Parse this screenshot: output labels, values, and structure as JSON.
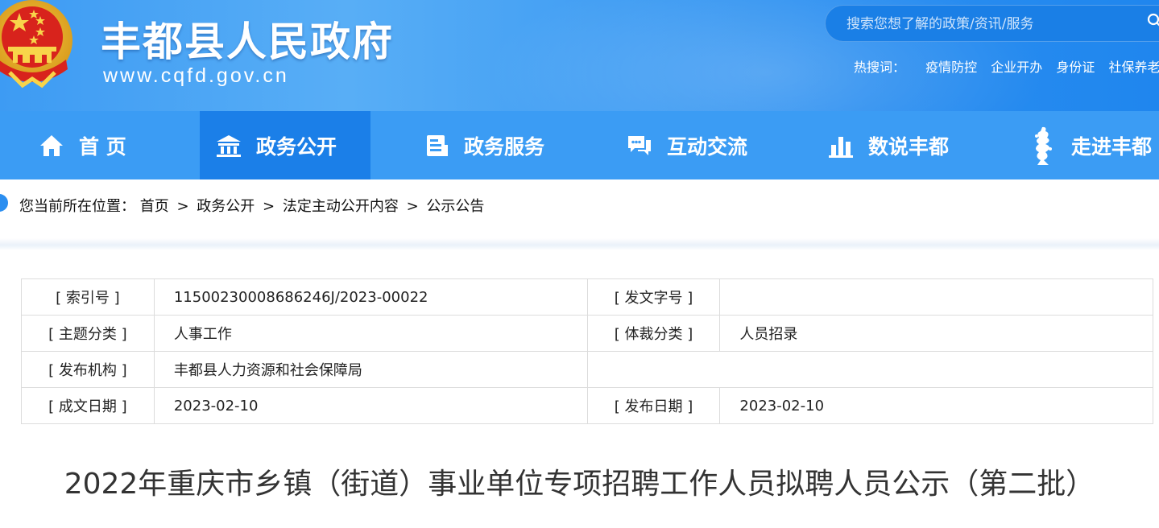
{
  "header": {
    "site_title": "丰都县人民政府",
    "site_domain": "www.cqfd.gov.cn",
    "search_placeholder": "搜索您想了解的政策/资讯/服务",
    "hot_label": "热搜词：",
    "hot_words": [
      "疫情防控",
      "企业开办",
      "身份证",
      "社保养老"
    ]
  },
  "nav": {
    "items": [
      {
        "label": "首 页",
        "icon": "home-icon"
      },
      {
        "label": "政务公开",
        "icon": "building-icon",
        "active": true
      },
      {
        "label": "政务服务",
        "icon": "document-icon"
      },
      {
        "label": "互动交流",
        "icon": "chat-icon"
      },
      {
        "label": "数说丰都",
        "icon": "bar-chart-icon"
      },
      {
        "label": "走进丰都",
        "icon": "figure-icon"
      }
    ]
  },
  "breadcrumb": {
    "prefix": "您当前所在位置：",
    "items": [
      "首页",
      "政务公开",
      "法定主动公开内容",
      "公示公告"
    ],
    "separator": ">"
  },
  "meta": {
    "rows": [
      {
        "l1": "[ 索引号 ]",
        "v1": "11500230008686246J/2023-00022",
        "l2": "[ 发文字号 ]",
        "v2": ""
      },
      {
        "l1": "[ 主题分类 ]",
        "v1": "人事工作",
        "l2": "[ 体裁分类 ]",
        "v2": "人员招录"
      },
      {
        "l1": "[ 发布机构 ]",
        "v1": "丰都县人力资源和社会保障局"
      },
      {
        "l1": "[ 成文日期 ]",
        "v1": "2023-02-10",
        "l2": "[ 发布日期 ]",
        "v2": "2023-02-10"
      }
    ]
  },
  "article": {
    "title": "2022年重庆市乡镇（街道）事业单位专项招聘工作人员拟聘人员公示（第二批）"
  },
  "colors": {
    "header_blue": "#3d9bf3",
    "nav_blue": "#3b9cf4",
    "nav_active": "#1b7fe8"
  }
}
